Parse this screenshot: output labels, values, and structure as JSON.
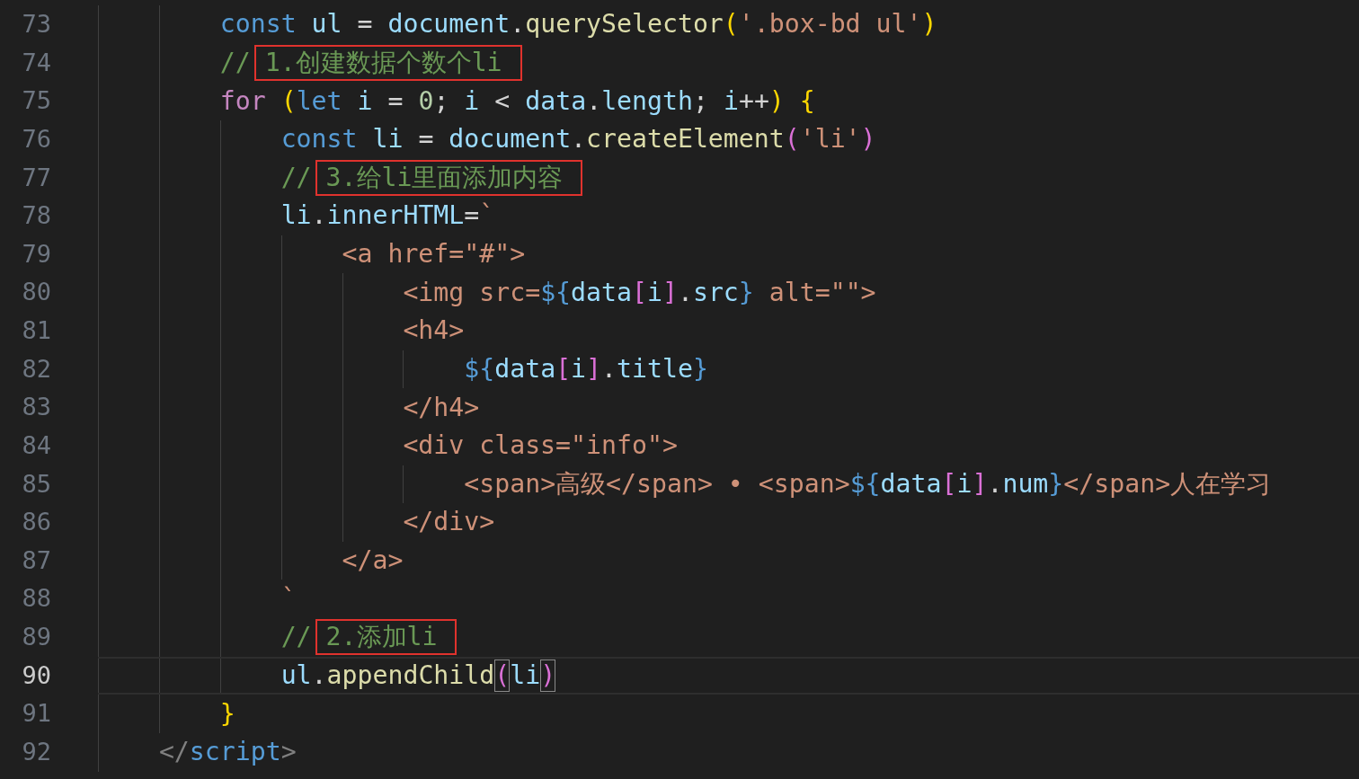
{
  "editor": {
    "lines": [
      {
        "children": [
          {
            "number": "73",
            "current": false,
            "tokens": [
              {
                "text": "const",
                "kind": "keyword"
              },
              {
                "text": " ul",
                "kind": "variable"
              },
              {
                "text": " = ",
                "kind": "operator"
              },
              {
                "text": "document",
                "kind": "variable"
              },
              {
                "text": ".",
                "kind": "operator"
              },
              {
                "text": "querySelector",
                "kind": "function"
              },
              {
                "text": "(",
                "kind": "bracket-gold"
              },
              {
                "text": "'.box-bd ul'",
                "kind": "string"
              },
              {
                "text": ")",
                "kind": "bracket-gold"
              }
            ]
          },
          {
            "number": "74",
            "current": false,
            "tokens": [
              {
                "text": "//",
                "kind": "comment"
              },
              {
                "text": "1.创建数据个数个li",
                "kind": "boxed-comment"
              }
            ]
          },
          {
            "number": "75",
            "current": false,
            "tokens": [
              {
                "text": "for",
                "kind": "control"
              },
              {
                "text": " (",
                "kind": "bracket-gold"
              },
              {
                "text": "let",
                "kind": "keyword"
              },
              {
                "text": " i",
                "kind": "variable"
              },
              {
                "text": " = ",
                "kind": "operator"
              },
              {
                "text": "0",
                "kind": "number"
              },
              {
                "text": "; ",
                "kind": "operator"
              },
              {
                "text": "i",
                "kind": "variable"
              },
              {
                "text": " < ",
                "kind": "operator"
              },
              {
                "text": "data",
                "kind": "variable"
              },
              {
                "text": ".",
                "kind": "operator"
              },
              {
                "text": "length",
                "kind": "variable"
              },
              {
                "text": "; ",
                "kind": "operator"
              },
              {
                "text": "i",
                "kind": "variable"
              },
              {
                "text": "++",
                "kind": "operator"
              },
              {
                "text": ")",
                "kind": "bracket-gold"
              },
              {
                "text": " {",
                "kind": "bracket-gold"
              }
            ],
            "children": [
              {
                "number": "76",
                "current": false,
                "tokens": [
                  {
                    "text": "const",
                    "kind": "keyword"
                  },
                  {
                    "text": " li",
                    "kind": "variable"
                  },
                  {
                    "text": " = ",
                    "kind": "operator"
                  },
                  {
                    "text": "document",
                    "kind": "variable"
                  },
                  {
                    "text": ".",
                    "kind": "operator"
                  },
                  {
                    "text": "createElement",
                    "kind": "function"
                  },
                  {
                    "text": "(",
                    "kind": "bracket-orchid"
                  },
                  {
                    "text": "'li'",
                    "kind": "string"
                  },
                  {
                    "text": ")",
                    "kind": "bracket-orchid"
                  }
                ]
              },
              {
                "number": "77",
                "current": false,
                "tokens": [
                  {
                    "text": "//",
                    "kind": "comment"
                  },
                  {
                    "text": "3.给li里面添加内容",
                    "kind": "boxed-comment"
                  }
                ]
              },
              {
                "number": "78",
                "current": false,
                "tokens": [
                  {
                    "text": "li",
                    "kind": "variable"
                  },
                  {
                    "text": ".",
                    "kind": "operator"
                  },
                  {
                    "text": "innerHTML",
                    "kind": "variable"
                  },
                  {
                    "text": "=",
                    "kind": "operator"
                  },
                  {
                    "text": "`",
                    "kind": "string"
                  }
                ],
                "children": [
                  {
                    "number": "79",
                    "current": false,
                    "tokens": [
                      {
                        "text": "<a href=\"#\">",
                        "kind": "string"
                      }
                    ],
                    "children": [
                      {
                        "number": "80",
                        "current": false,
                        "tokens": [
                          {
                            "text": "<img src=",
                            "kind": "string"
                          },
                          {
                            "text": "${",
                            "kind": "keyword"
                          },
                          {
                            "text": "data",
                            "kind": "variable"
                          },
                          {
                            "text": "[",
                            "kind": "bracket-orchid"
                          },
                          {
                            "text": "i",
                            "kind": "variable"
                          },
                          {
                            "text": "]",
                            "kind": "bracket-orchid"
                          },
                          {
                            "text": ".",
                            "kind": "operator"
                          },
                          {
                            "text": "src",
                            "kind": "variable"
                          },
                          {
                            "text": "}",
                            "kind": "keyword"
                          },
                          {
                            "text": " alt=\"\">",
                            "kind": "string"
                          }
                        ]
                      },
                      {
                        "number": "81",
                        "current": false,
                        "tokens": [
                          {
                            "text": "<h4>",
                            "kind": "string"
                          }
                        ],
                        "children": [
                          {
                            "number": "82",
                            "current": false,
                            "tokens": [
                              {
                                "text": "${",
                                "kind": "keyword"
                              },
                              {
                                "text": "data",
                                "kind": "variable"
                              },
                              {
                                "text": "[",
                                "kind": "bracket-orchid"
                              },
                              {
                                "text": "i",
                                "kind": "variable"
                              },
                              {
                                "text": "]",
                                "kind": "bracket-orchid"
                              },
                              {
                                "text": ".",
                                "kind": "operator"
                              },
                              {
                                "text": "title",
                                "kind": "variable"
                              },
                              {
                                "text": "}",
                                "kind": "keyword"
                              }
                            ]
                          }
                        ]
                      },
                      {
                        "number": "83",
                        "current": false,
                        "tokens": [
                          {
                            "text": "</h4>",
                            "kind": "string"
                          }
                        ]
                      },
                      {
                        "number": "84",
                        "current": false,
                        "tokens": [
                          {
                            "text": "<div class=\"info\">",
                            "kind": "string"
                          }
                        ],
                        "children": [
                          {
                            "number": "85",
                            "current": false,
                            "tokens": [
                              {
                                "text": "<span>高级</span> • <span>",
                                "kind": "string"
                              },
                              {
                                "text": "${",
                                "kind": "keyword"
                              },
                              {
                                "text": "data",
                                "kind": "variable"
                              },
                              {
                                "text": "[",
                                "kind": "bracket-orchid"
                              },
                              {
                                "text": "i",
                                "kind": "variable"
                              },
                              {
                                "text": "]",
                                "kind": "bracket-orchid"
                              },
                              {
                                "text": ".",
                                "kind": "operator"
                              },
                              {
                                "text": "num",
                                "kind": "variable"
                              },
                              {
                                "text": "}",
                                "kind": "keyword"
                              },
                              {
                                "text": "</span>人在学习",
                                "kind": "string"
                              }
                            ]
                          }
                        ]
                      },
                      {
                        "number": "86",
                        "current": false,
                        "tokens": [
                          {
                            "text": "</div>",
                            "kind": "string"
                          }
                        ]
                      }
                    ]
                  },
                  {
                    "number": "87",
                    "current": false,
                    "tokens": [
                      {
                        "text": "</a>",
                        "kind": "string"
                      }
                    ]
                  }
                ]
              },
              {
                "number": "88",
                "current": false,
                "tokens": [
                  {
                    "text": "`",
                    "kind": "string"
                  }
                ]
              },
              {
                "number": "89",
                "current": false,
                "tokens": [
                  {
                    "text": "//",
                    "kind": "comment"
                  },
                  {
                    "text": "2.添加li",
                    "kind": "boxed-comment"
                  }
                ]
              },
              {
                "number": "90",
                "current": true,
                "tokens": [
                  {
                    "text": "ul",
                    "kind": "variable"
                  },
                  {
                    "text": ".",
                    "kind": "operator"
                  },
                  {
                    "text": "appendChild",
                    "kind": "function"
                  },
                  {
                    "text": "(",
                    "kind": "matched-bracket"
                  },
                  {
                    "text": "li",
                    "kind": "variable"
                  },
                  {
                    "text": ")",
                    "kind": "matched-bracket"
                  }
                ]
              }
            ]
          },
          {
            "number": "91",
            "current": false,
            "tokens": [
              {
                "text": "}",
                "kind": "bracket-gold"
              }
            ]
          }
        ]
      },
      {
        "number": "92",
        "current": false,
        "tokens": [
          {
            "text": "</",
            "kind": "tag-punct"
          },
          {
            "text": "script",
            "kind": "keyword"
          },
          {
            "text": ">",
            "kind": "tag-punct"
          }
        ]
      }
    ]
  }
}
